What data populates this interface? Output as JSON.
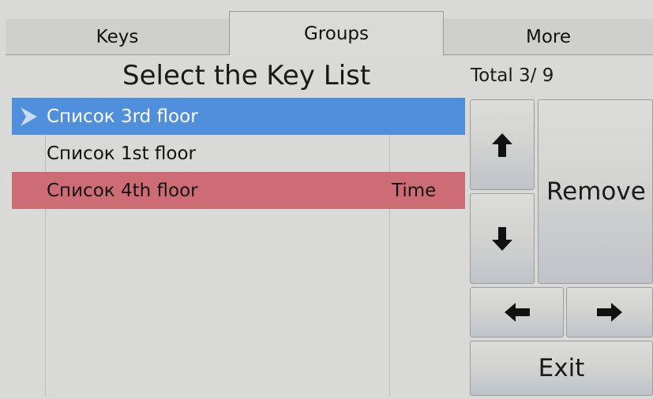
{
  "tabs": {
    "keys": "Keys",
    "groups": "Groups",
    "more": "More"
  },
  "header": {
    "title": "Select the Key List",
    "total": "Total 3/ 9"
  },
  "list": {
    "rows": [
      {
        "name": "Список 3rd floor",
        "extra": "",
        "state": "selected"
      },
      {
        "name": "Список 1st floor",
        "extra": "",
        "state": "normal"
      },
      {
        "name": "Список 4th floor",
        "extra": "Time",
        "state": "alert"
      }
    ]
  },
  "buttons": {
    "up_icon": "arrow-up-icon",
    "down_icon": "arrow-down-icon",
    "left_icon": "arrow-left-icon",
    "right_icon": "arrow-right-icon",
    "remove": "Remove",
    "exit": "Exit"
  },
  "colors": {
    "selected_row": "#4f8fdb",
    "alert_row": "#cd6c74",
    "background": "#d9d9d7"
  }
}
